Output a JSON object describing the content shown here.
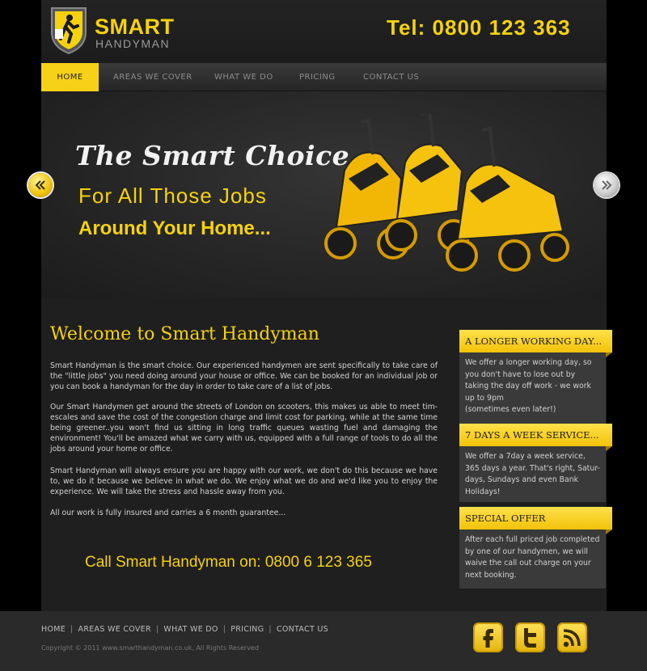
{
  "header": {
    "logo_title": "SMART",
    "logo_subtitle": "HANDYMAN",
    "phone": "Tel:  0800 123 363"
  },
  "nav": {
    "items": [
      "HOME",
      "AREAS WE COVER",
      "WHAT WE DO",
      "PRICING",
      "CONTACT US"
    ],
    "active": "HOME"
  },
  "hero": {
    "line1": "The Smart Choice",
    "line2": "For All Those Jobs",
    "line3": "Around Your Home..."
  },
  "main": {
    "title": "Welcome to Smart Handyman",
    "paragraphs": [
      "Smart Handyman is the smart choice. Our experienced handymen are sent specifically to take care of the \"little jobs\" you need doing around your house or office. We can be booked for an individual job or you can book a handyman for the day in order to take care of a list of jobs.",
      "Our Smart Handymen get around the streets of London on scooters, this makes us able to meet tim-escales and save the cost of the congestion charge and limit cost for parking, while at the same time being greener..you won't find us sitting in long traffic queues wasting fuel and damaging the environment!  You'll be amazed what we carry with us, equipped with a full range of tools to do all the jobs around your home or office.",
      "Smart Handyman will always ensure you are happy with our work, we don't do this because we have to, we do it because we believe in what we do. We enjoy what we do and we'd like you to enjoy the experience. We will take the stress and hassle away from you.",
      "All our work is fully insured and carries a 6 month guarantee..."
    ],
    "cta": "Call Smart Handyman on: 0800 6 123 365"
  },
  "sidebar": {
    "boxes": [
      {
        "title": "A LONGER WORKING DAY...",
        "body": "We offer a longer working day, so you don't have to lose out by taking the day off work - we work up to 9pm\n(sometimes even later!)"
      },
      {
        "title": "7 DAYS A WEEK SERVICE...",
        "body": "We offer a 7day a week service, 365 days a year. That's right, Satur-days, Sundays and even Bank Holidays!"
      },
      {
        "title": "SPECIAL OFFER",
        "body": "After each full priced job completed by one of our handymen, we will waive the call out charge on your next booking."
      }
    ]
  },
  "footer": {
    "links": [
      "HOME",
      "AREAS WE COVER",
      "WHAT WE DO",
      "PRICING",
      "CONTACT US"
    ],
    "separator": "|",
    "copyright": "Copyright © 2011 www.smarthandyman.co.uk, All Rights Reserved",
    "social": [
      "facebook-icon",
      "twitter-icon",
      "rss-icon"
    ]
  },
  "colors": {
    "accent": "#f5d20d",
    "background": "#1f1f1f",
    "sidebar_box": "#3a3a3a"
  }
}
